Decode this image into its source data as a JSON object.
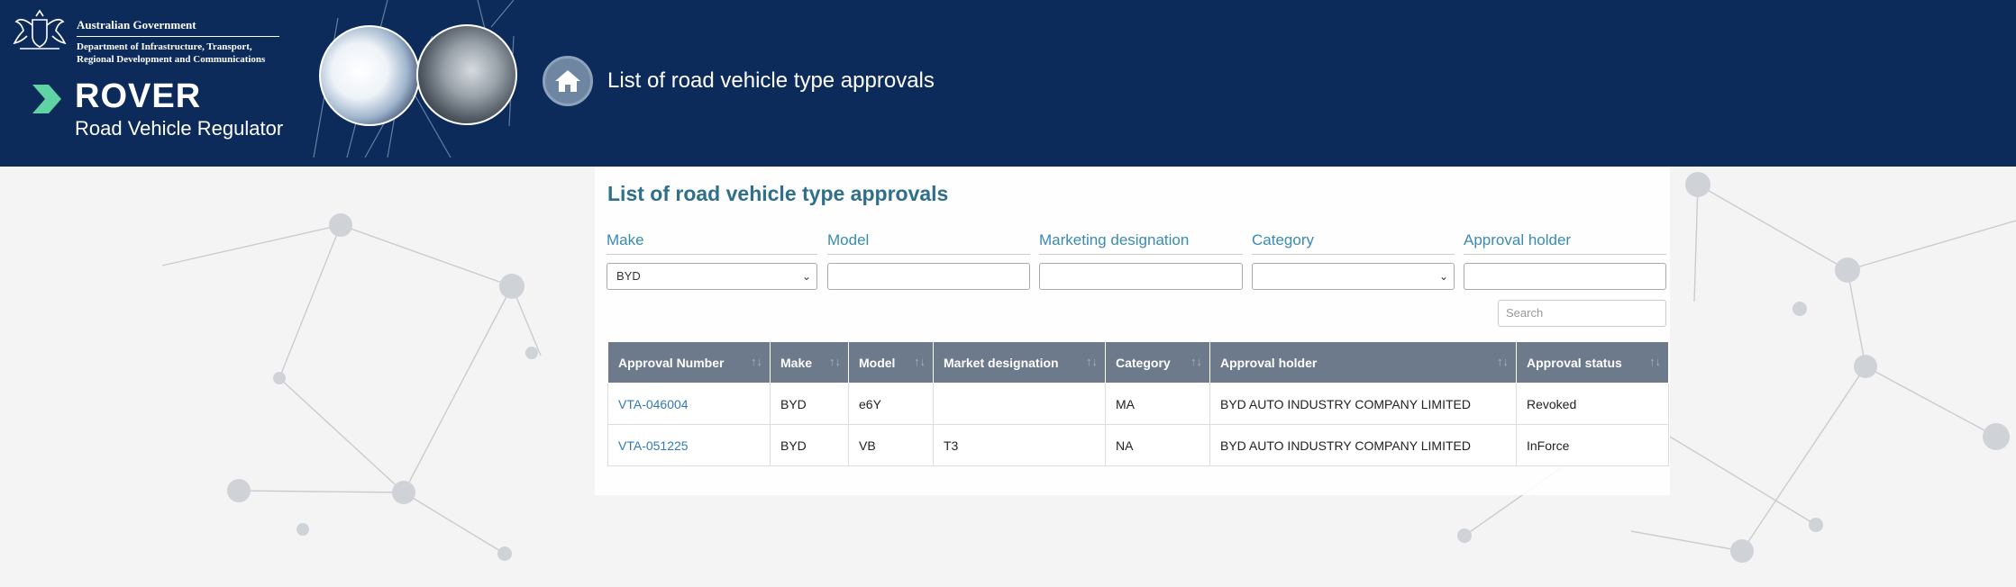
{
  "header": {
    "gov_title": "Australian Government",
    "dept_line1": "Department of Infrastructure, Transport,",
    "dept_line2": "Regional Development and Communications",
    "app_name": "ROVER",
    "app_subtitle": "Road Vehicle Regulator",
    "page_heading": "List of road vehicle type approvals",
    "home_icon": "home-icon",
    "colors": {
      "bar": "#0d2b5a",
      "chevron": "#5fd3a3"
    }
  },
  "main": {
    "title": "List of road vehicle type approvals",
    "filters": {
      "make": {
        "label": "Make",
        "value": "BYD"
      },
      "model": {
        "label": "Model",
        "value": ""
      },
      "marketing": {
        "label": "Marketing designation",
        "value": ""
      },
      "category": {
        "label": "Category",
        "value": ""
      },
      "holder": {
        "label": "Approval holder",
        "value": ""
      }
    },
    "search": {
      "placeholder": "Search"
    },
    "table": {
      "columns": [
        "Approval Number",
        "Make",
        "Model",
        "Market designation",
        "Category",
        "Approval holder",
        "Approval status"
      ],
      "rows": [
        [
          "VTA-046004",
          "BYD",
          "e6Y",
          "",
          "MA",
          "BYD AUTO INDUSTRY COMPANY LIMITED",
          "Revoked"
        ],
        [
          "VTA-051225",
          "BYD",
          "VB",
          "T3",
          "NA",
          "BYD AUTO INDUSTRY COMPANY LIMITED",
          "InForce"
        ]
      ]
    }
  }
}
